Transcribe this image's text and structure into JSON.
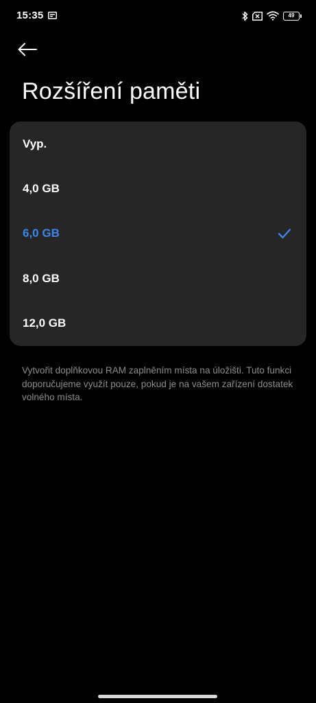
{
  "status_bar": {
    "time": "15:35",
    "battery_level": "49",
    "icons": [
      "notification-icon",
      "bluetooth-icon",
      "sim-disabled-icon",
      "wifi-icon",
      "battery-icon"
    ]
  },
  "header": {
    "back_icon": "arrow-left-icon",
    "title": "Rozšíření paměti"
  },
  "options": [
    {
      "label": "Vyp.",
      "selected": false
    },
    {
      "label": "4,0 GB",
      "selected": false
    },
    {
      "label": "6,0 GB",
      "selected": true
    },
    {
      "label": "8,0 GB",
      "selected": false
    },
    {
      "label": "12,0 GB",
      "selected": false
    }
  ],
  "description": "Vytvořit doplňkovou RAM zaplněním místa na úložišti. Tuto funkci doporučujeme využít pouze, pokud je na vašem zařízení dostatek volného místa.",
  "colors": {
    "background": "#000000",
    "card": "#262626",
    "accent": "#3d86e8",
    "secondary_text": "#8c8c8c"
  }
}
